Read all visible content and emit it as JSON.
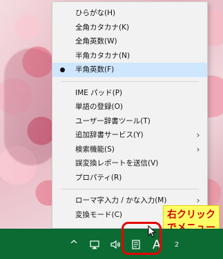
{
  "context_menu": {
    "items": [
      {
        "label": "ひらがな(H)",
        "has_submenu": false,
        "selected": false
      },
      {
        "label": "全角カタカナ(K)",
        "has_submenu": false,
        "selected": false
      },
      {
        "label": "全角英数(W)",
        "has_submenu": false,
        "selected": false
      },
      {
        "label": "半角カタカナ(N)",
        "has_submenu": false,
        "selected": false
      },
      {
        "label": "半角英数(F)",
        "has_submenu": false,
        "selected": true
      },
      {
        "label": "IME パッド(P)",
        "has_submenu": false,
        "selected": false
      },
      {
        "label": "単語の登録(O)",
        "has_submenu": false,
        "selected": false
      },
      {
        "label": "ユーザー辞書ツール(T)",
        "has_submenu": false,
        "selected": false
      },
      {
        "label": "追加辞書サービス(Y)",
        "has_submenu": true,
        "selected": false
      },
      {
        "label": "検索機能(S)",
        "has_submenu": true,
        "selected": false
      },
      {
        "label": "誤変換レポートを送信(V)",
        "has_submenu": false,
        "selected": false
      },
      {
        "label": "プロパティ(R)",
        "has_submenu": false,
        "selected": false
      },
      {
        "label": "ローマ字入力 / かな入力(M)",
        "has_submenu": true,
        "selected": false
      },
      {
        "label": "変換モード(C)",
        "has_submenu": true,
        "selected": false
      }
    ],
    "submenu_arrow": "›",
    "selected_bullet": "●"
  },
  "annotation": {
    "text": "右クリック\nでメニュー\nが出る",
    "color": "#d20000",
    "background": "#ffff66"
  },
  "taskbar": {
    "color": "#0b6b33",
    "tray": {
      "caret": "^",
      "ime_indicator": "A",
      "clock_partial": "2"
    }
  }
}
